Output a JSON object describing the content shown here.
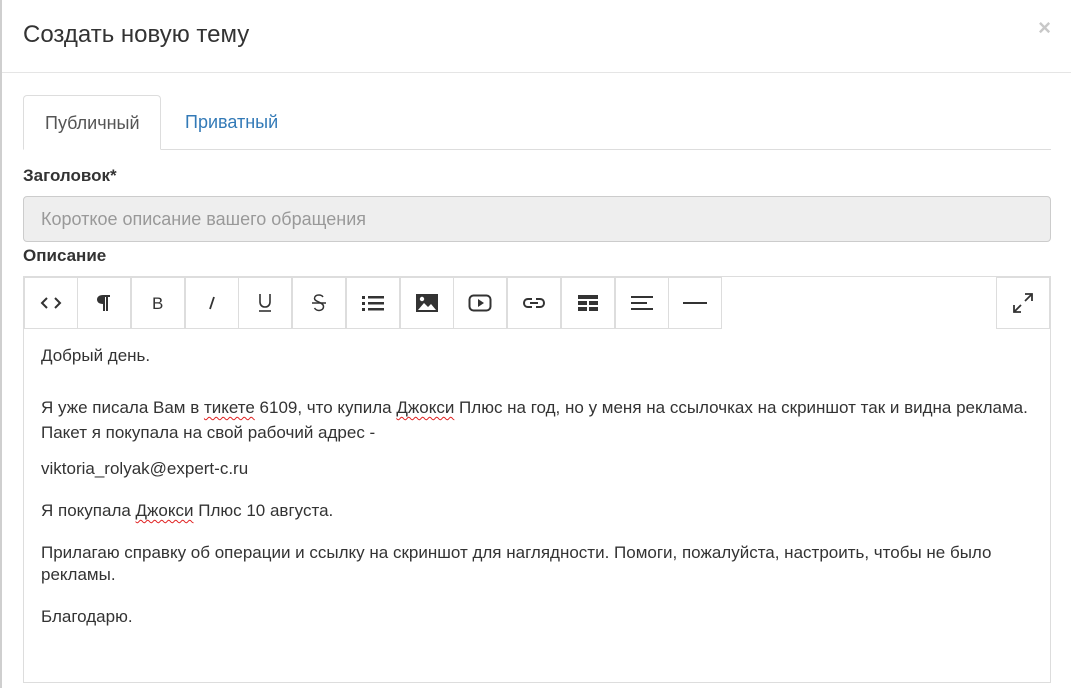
{
  "modal": {
    "title": "Создать новую тему",
    "close_glyph": "×"
  },
  "tabs": [
    {
      "label": "Публичный",
      "active": true
    },
    {
      "label": "Приватный",
      "active": false
    }
  ],
  "form": {
    "title_label": "Заголовок*",
    "title_placeholder": "Короткое описание вашего обращения",
    "title_value": "",
    "description_label": "Описание"
  },
  "toolbar": {
    "buttons": [
      {
        "icon": "code-view-icon"
      },
      {
        "icon": "paragraph-icon"
      },
      {
        "icon": "bold-icon"
      },
      {
        "icon": "italic-icon"
      },
      {
        "icon": "underline-icon"
      },
      {
        "icon": "strikethrough-icon"
      },
      {
        "icon": "unordered-list-icon"
      },
      {
        "icon": "image-icon"
      },
      {
        "icon": "video-icon"
      },
      {
        "icon": "link-icon"
      },
      {
        "icon": "table-icon"
      },
      {
        "icon": "align-icon"
      },
      {
        "icon": "horizontal-rule-icon"
      }
    ],
    "fullscreen_icon": "fullscreen-icon"
  },
  "editor": {
    "greeting": "Добрый день.",
    "p1_a": "Я уже писала Вам в ",
    "p1_w1": "тикете",
    "p1_b": " 6109, что купила ",
    "p1_w2": "Джокси",
    "p1_c": " Плюс на год, но у меня на ссылочках на скриншот так и видна реклама. Пакет я покупала на свой рабочий адрес -",
    "email": "viktoria_rolyak@expert-c.ru",
    "p3_a": "Я покупала ",
    "p3_w": "Джокси",
    "p3_b": " Плюс 10 августа.",
    "p4": "Прилагаю справку об операции и ссылку на скриншот для наглядности. Помоги, пожалуйста, настроить, чтобы не было рекламы.",
    "p5": "Благодарю."
  },
  "colors": {
    "link": "#337ab7",
    "spellcheck": "#e02020",
    "input_bg": "#eeeeee"
  }
}
